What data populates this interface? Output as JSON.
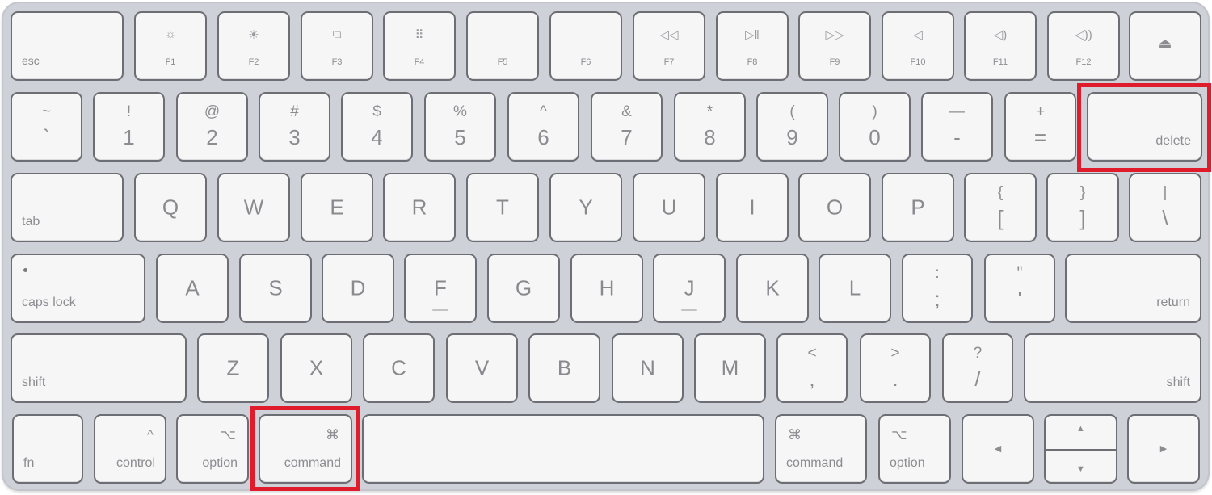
{
  "keyboard": {
    "row_function": {
      "esc": "esc",
      "keys": [
        {
          "label": "F1",
          "icon": "☼",
          "icon_name": "brightness-down-icon"
        },
        {
          "label": "F2",
          "icon": "☀",
          "icon_name": "brightness-up-icon"
        },
        {
          "label": "F3",
          "icon": "⧉",
          "icon_name": "mission-control-icon"
        },
        {
          "label": "F4",
          "icon": "⠿",
          "icon_name": "launchpad-icon"
        },
        {
          "label": "F5",
          "icon": "",
          "icon_name": ""
        },
        {
          "label": "F6",
          "icon": "",
          "icon_name": ""
        },
        {
          "label": "F7",
          "icon": "◁◁",
          "icon_name": "rewind-icon"
        },
        {
          "label": "F8",
          "icon": "▷‖",
          "icon_name": "play-pause-icon"
        },
        {
          "label": "F9",
          "icon": "▷▷",
          "icon_name": "fast-forward-icon"
        },
        {
          "label": "F10",
          "icon": "◁",
          "icon_name": "mute-icon"
        },
        {
          "label": "F11",
          "icon": "◁)",
          "icon_name": "volume-down-icon"
        },
        {
          "label": "F12",
          "icon": "◁))",
          "icon_name": "volume-up-icon"
        }
      ],
      "eject_icon": "⏏"
    },
    "row_numbers": {
      "keys": [
        {
          "top": "~",
          "bottom": "`"
        },
        {
          "top": "!",
          "bottom": "1"
        },
        {
          "top": "@",
          "bottom": "2"
        },
        {
          "top": "#",
          "bottom": "3"
        },
        {
          "top": "$",
          "bottom": "4"
        },
        {
          "top": "%",
          "bottom": "5"
        },
        {
          "top": "^",
          "bottom": "6"
        },
        {
          "top": "&",
          "bottom": "7"
        },
        {
          "top": "*",
          "bottom": "8"
        },
        {
          "top": "(",
          "bottom": "9"
        },
        {
          "top": ")",
          "bottom": "0"
        },
        {
          "top": "—",
          "bottom": "-"
        },
        {
          "top": "+",
          "bottom": "="
        }
      ],
      "delete": "delete"
    },
    "row_qwerty": {
      "tab": "tab",
      "letters": [
        "Q",
        "W",
        "E",
        "R",
        "T",
        "Y",
        "U",
        "I",
        "O",
        "P"
      ],
      "brackets": [
        {
          "top": "{",
          "bottom": "["
        },
        {
          "top": "}",
          "bottom": "]"
        },
        {
          "top": "|",
          "bottom": "\\"
        }
      ]
    },
    "row_home": {
      "caps_lock": "caps lock",
      "letters": [
        "A",
        "S",
        "D",
        "F",
        "G",
        "H",
        "J",
        "K",
        "L"
      ],
      "punct": [
        {
          "top": ":",
          "bottom": ";"
        },
        {
          "top": "\"",
          "bottom": "'"
        }
      ],
      "return": "return"
    },
    "row_bottom_letters": {
      "shift_left": "shift",
      "letters": [
        "Z",
        "X",
        "C",
        "V",
        "B",
        "N",
        "M"
      ],
      "punct": [
        {
          "top": "<",
          "bottom": ","
        },
        {
          "top": ">",
          "bottom": "."
        },
        {
          "top": "?",
          "bottom": "/"
        }
      ],
      "shift_right": "shift"
    },
    "row_modifiers": {
      "fn": "fn",
      "control": {
        "label": "control",
        "symbol": "^"
      },
      "option_left": {
        "label": "option",
        "symbol": "⌥"
      },
      "command_left": {
        "label": "command",
        "symbol": "⌘"
      },
      "command_right": {
        "label": "command",
        "symbol": "⌘"
      },
      "option_right": {
        "label": "option",
        "symbol": "⌥"
      },
      "arrows": {
        "left": "◀",
        "up": "▲",
        "down": "▼",
        "right": "▶"
      }
    },
    "highlighted_keys": [
      "delete",
      "command (left)"
    ],
    "highlight_color": "#e01b2b"
  }
}
